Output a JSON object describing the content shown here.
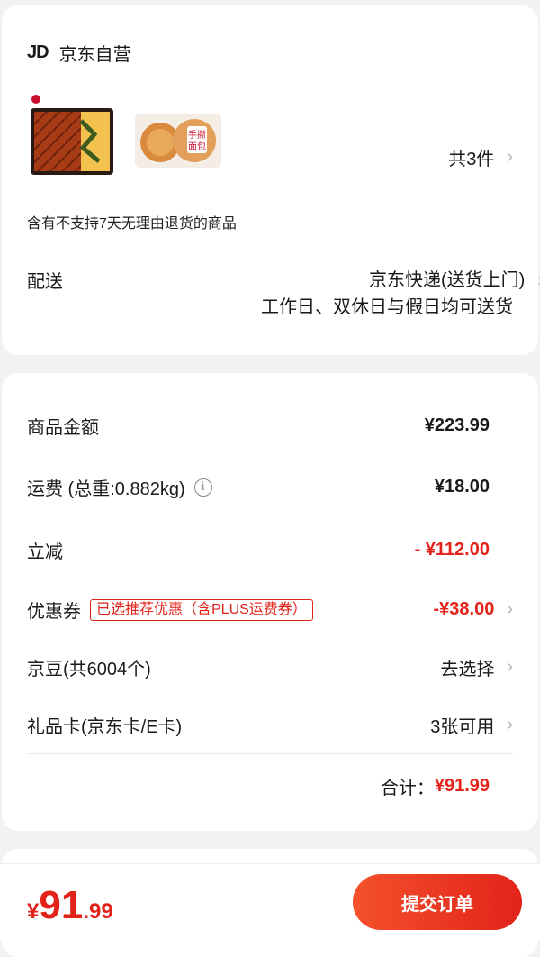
{
  "store": {
    "logo": "JD",
    "name": "京东自营"
  },
  "products": {
    "count_label": "共3件"
  },
  "notice": "含有不支持7天无理由退货的商品",
  "delivery": {
    "label": "配送",
    "method": "京东快递(送货上门)",
    "note": "工作日、双休日与假日均可送货"
  },
  "summary": {
    "goods": {
      "label": "商品金额",
      "value": "¥223.99"
    },
    "shipping": {
      "label": "运费 (总重:0.882kg)",
      "value": "¥18.00"
    },
    "discount": {
      "label": "立减",
      "value": "- ¥112.00"
    },
    "coupon": {
      "label": "优惠券",
      "tag": "已选推荐优惠（含PLUS运费券）",
      "value": "-¥38.00"
    },
    "beans": {
      "label": "京豆(共6004个)",
      "value": "去选择"
    },
    "giftcard": {
      "label": "礼品卡(京东卡/E卡)",
      "value": "3张可用"
    },
    "total": {
      "label": "合计：",
      "value": "¥91.99"
    }
  },
  "footer": {
    "price_symbol": "¥",
    "price_int": "91",
    "price_dec": ".99",
    "submit_label": "提交订单"
  },
  "colors": {
    "accent": "#e2231a"
  }
}
